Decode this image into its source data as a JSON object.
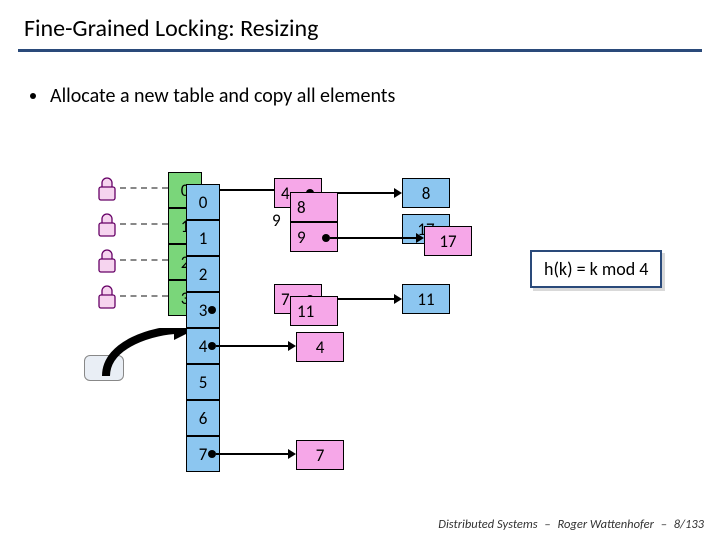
{
  "title": "Fine-Grained Locking: Resizing",
  "bullet": "Allocate a new table and copy all elements",
  "hash_formula": "h(k) = k mod 4",
  "old_table": {
    "indices": [
      "0",
      "1",
      "2",
      "3"
    ]
  },
  "new_table": {
    "indices": [
      "0",
      "1",
      "2",
      "3",
      "4",
      "5",
      "6",
      "7"
    ]
  },
  "old_row0": {
    "a": "4",
    "b": "8"
  },
  "old_row0_back": {
    "a": "8",
    "b": "9"
  },
  "old_row1": {
    "a": "9",
    "b": "17"
  },
  "old_row1_back": {
    "b": "17"
  },
  "old_row3": {
    "a": "7",
    "b": "11"
  },
  "old_row3_back": {
    "a": "11"
  },
  "new_row3": {
    "a": "11"
  },
  "new_row4": {
    "a": "4"
  },
  "new_row7": {
    "a": "7"
  },
  "footer": {
    "course": "Distributed Systems",
    "author": "Roger Wattenhofer",
    "page": "8/133"
  }
}
